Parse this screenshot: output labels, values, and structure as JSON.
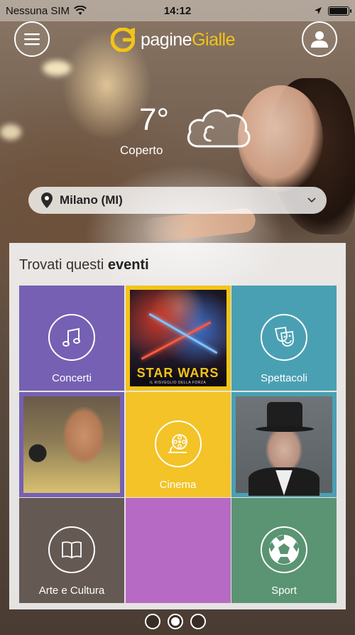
{
  "statusbar": {
    "carrier": "Nessuna SIM",
    "time": "14:12",
    "battery_level": 0.95
  },
  "header": {
    "logo_text_part1": "pagine",
    "logo_text_part2": "Gialle"
  },
  "weather": {
    "temperature": "7°",
    "condition": "Coperto",
    "icon": "cloud-icon"
  },
  "location": {
    "city": "Milano (MI)"
  },
  "events": {
    "title_prefix": "Trovati questi ",
    "title_bold": "eventi",
    "tiles": [
      {
        "label": "Concerti",
        "icon": "music-note-icon",
        "color": "#7560b3"
      },
      {
        "label": "",
        "icon": "poster-image",
        "poster_title": "STAR WARS",
        "poster_subtitle": "IL RISVEGLIO DELLA FORZA"
      },
      {
        "label": "Spettacoli",
        "icon": "theater-masks-icon",
        "color": "#4aa0b3"
      },
      {
        "label": "",
        "icon": "singer-photo"
      },
      {
        "label": "Cinema",
        "icon": "film-reel-icon",
        "color": "#f3c327"
      },
      {
        "label": "",
        "icon": "man-in-hat-photo"
      },
      {
        "label": "Arte e Cultura",
        "icon": "book-icon",
        "color": "#655953"
      },
      {
        "label": "",
        "icon": "",
        "color": "#b76ac3"
      },
      {
        "label": "Sport",
        "icon": "soccer-ball-icon",
        "color": "#5a9473"
      }
    ]
  },
  "pager": {
    "pages": 3,
    "active": 1
  },
  "colors": {
    "accent": "#f2c418"
  }
}
